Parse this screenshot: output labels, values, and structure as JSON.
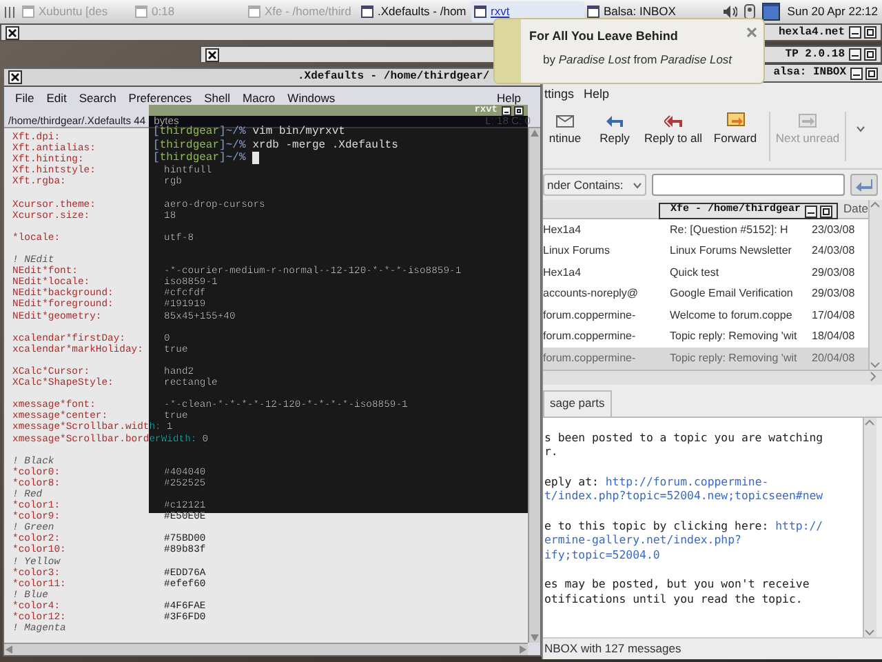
{
  "panel": {
    "tasks": [
      {
        "label": "Xubuntu [des",
        "minimized": true,
        "selected": false
      },
      {
        "label": "0:18",
        "minimized": true,
        "selected": false
      },
      {
        "label": "Xfe - /home/third",
        "minimized": true,
        "selected": false
      },
      {
        "label": ".Xdefaults - /hom",
        "minimized": false,
        "selected": false
      },
      {
        "label": "rxvt",
        "minimized": false,
        "selected": true
      },
      {
        "label": "Balsa: INBOX",
        "minimized": false,
        "selected": false
      }
    ],
    "clock": "Sun 20 Apr 22:12"
  },
  "background_windows": [
    {
      "title": "hexla4.net"
    },
    {
      "title": "TP 2.0.18"
    }
  ],
  "notification": {
    "title": "For All You Leave Behind",
    "text": "by *Paradise Lost* from *Paradise Lost*"
  },
  "editor": {
    "title": ".Xdefaults - /home/thirdgear/",
    "menu": [
      "File",
      "Edit",
      "Search",
      "Preferences",
      "Shell",
      "Macro",
      "Windows",
      "Help"
    ],
    "path": "/home/thirdgear/.Xdefaults 44",
    "path_suffix": "bytes",
    "position": "L: 18  C: 0",
    "lines": [
      {
        "kind": "setting",
        "key": "Xft.dpi:"
      },
      {
        "kind": "setting",
        "key": "Xft.antialias:"
      },
      {
        "kind": "setting",
        "key": "Xft.hinting:"
      },
      {
        "kind": "setting",
        "key": "Xft.hintstyle:",
        "value": "hintfull"
      },
      {
        "kind": "setting",
        "key": "Xft.rgba:",
        "value": "rgb"
      },
      {
        "kind": "blank"
      },
      {
        "kind": "setting",
        "key": "Xcursor.theme:",
        "value": "aero-drop-cursors"
      },
      {
        "kind": "setting",
        "key": "Xcursor.size:",
        "value": "18"
      },
      {
        "kind": "blank"
      },
      {
        "kind": "setting",
        "key": "*locale:",
        "value": "utf-8"
      },
      {
        "kind": "blank"
      },
      {
        "kind": "comment",
        "text": "! NEdit"
      },
      {
        "kind": "setting",
        "key": "NEdit*font:",
        "value": "-*-courier-medium-r-normal--12-120-*-*-*-iso8859-1"
      },
      {
        "kind": "setting",
        "key": "NEdit*locale:",
        "value": "iso8859-1"
      },
      {
        "kind": "setting",
        "key": "NEdit*background:",
        "value": "#cfcfdf"
      },
      {
        "kind": "setting",
        "key": "NEdit*foreground:",
        "value": "#191919"
      },
      {
        "kind": "setting",
        "key": "NEdit*geometry:",
        "value": "85x45+155+40"
      },
      {
        "kind": "blank"
      },
      {
        "kind": "setting",
        "key": "xcalendar*firstDay:",
        "value": "0"
      },
      {
        "kind": "setting",
        "key": "xcalendar*markHoliday:",
        "value": "true"
      },
      {
        "kind": "blank"
      },
      {
        "kind": "setting",
        "key": "XCalc*Cursor:",
        "value": "hand2"
      },
      {
        "kind": "setting",
        "key": "XCalc*ShapeStyle:",
        "value": "rectangle"
      },
      {
        "kind": "blank"
      },
      {
        "kind": "setting",
        "key": "xmessage*font:",
        "value": "-*-clean-*-*-*-*-12-120-*-*-*-*-iso8859-1"
      },
      {
        "kind": "setting",
        "key": "xmessage*center:",
        "value": "true"
      },
      {
        "kind": "setting",
        "key": "xmessage*Scrollbar.width:",
        "value": "1"
      },
      {
        "kind": "setting",
        "key": "xmessage*Scrollbar.borderWidth:",
        "value": "0"
      },
      {
        "kind": "blank"
      },
      {
        "kind": "comment",
        "text": "! Black"
      },
      {
        "kind": "setting",
        "key": "*color0:",
        "value": "#404040"
      },
      {
        "kind": "setting",
        "key": "*color8:",
        "value": "#252525"
      },
      {
        "kind": "comment",
        "text": "! Red"
      },
      {
        "kind": "setting",
        "key": "*color1:",
        "value": "#c12121"
      },
      {
        "kind": "setting",
        "key": "*color9:",
        "value": "#E50E0E"
      },
      {
        "kind": "comment",
        "text": "! Green"
      },
      {
        "kind": "setting",
        "key": "*color2:",
        "value": "#75BD00"
      },
      {
        "kind": "setting",
        "key": "*color10:",
        "value": "#89b83f"
      },
      {
        "kind": "comment",
        "text": "! Yellow"
      },
      {
        "kind": "setting",
        "key": "*color3:",
        "value": "#EDD76A"
      },
      {
        "kind": "setting",
        "key": "*color11:",
        "value": "#efef60"
      },
      {
        "kind": "comment",
        "text": "! Blue"
      },
      {
        "kind": "setting",
        "key": "*color4:",
        "value": "#4F6FAE"
      },
      {
        "kind": "setting",
        "key": "*color12:",
        "value": "#3F6FD0"
      },
      {
        "kind": "comment",
        "text": "! Magenta"
      }
    ]
  },
  "terminal": {
    "title": "rxvt",
    "bracket_open": "[",
    "bracket_close": "]",
    "lines": [
      {
        "user": "thirdgear",
        "prompt": "~/%",
        "command": "vim bin/myrxvt",
        "cursor": false
      },
      {
        "user": "thirdgear",
        "prompt": "~/%",
        "command": "xrdb -merge .Xdefaults",
        "cursor": false
      },
      {
        "user": "thirdgear",
        "prompt": "~/%",
        "cursor": true
      }
    ]
  },
  "mail": {
    "title": "alsa: INBOX",
    "menu": [
      "ttings",
      "Help"
    ],
    "toolbar": [
      {
        "kind": "continue",
        "label": "ntinue",
        "disabled": false
      },
      {
        "kind": "reply",
        "label": "Reply",
        "disabled": false
      },
      {
        "kind": "reply_all",
        "label": "Reply to all",
        "disabled": false
      },
      {
        "kind": "forward",
        "label": "Forward",
        "disabled": false
      },
      {
        "kind": "next",
        "label": "Next unread",
        "disabled": true
      }
    ],
    "filter": {
      "label": "nder Contains:"
    },
    "date_header": "Date",
    "messages": [
      {
        "sender": "Hex1a4",
        "subject": "Re: [Question #5152]: H",
        "date": "23/03/08",
        "selected": false
      },
      {
        "sender": "Linux Forums",
        "subject": "Linux Forums Newsletter",
        "date": "24/03/08",
        "selected": false
      },
      {
        "sender": "Hex1a4",
        "subject": "Quick test",
        "date": "29/03/08",
        "selected": false
      },
      {
        "sender": "accounts-noreply@",
        "subject": "Google Email Verification",
        "date": "29/03/08",
        "selected": false
      },
      {
        "sender": "forum.coppermine-",
        "subject": "Welcome to forum.coppe",
        "date": "17/04/08",
        "selected": false
      },
      {
        "sender": "forum.coppermine-",
        "subject": "Topic reply: Removing 'wit",
        "date": "18/04/08",
        "selected": false
      },
      {
        "sender": "forum.coppermine-",
        "subject": "Topic reply: Removing 'wit",
        "date": "20/04/08",
        "selected": true
      }
    ],
    "tab": "sage parts",
    "body": [
      [
        {
          "text": "s been posted to a topic you are watching"
        },
        {
          "text": "r."
        }
      ],
      [
        {
          "text": "eply at: ",
          "link": "http://forum.coppermine-"
        },
        {
          "link": "t/index.php?topic=52004.new;topicseen#new"
        }
      ],
      [
        {
          "text": "e to this topic by clicking here: ",
          "link": "http://"
        },
        {
          "link": "ermine-gallery.net/index.php?"
        },
        {
          "link": "ify;topic=52004.0"
        }
      ],
      [
        {
          "text": "es may be posted, but you won't receive"
        },
        {
          "text": "otifications until you read the topic."
        }
      ]
    ],
    "status": "NBOX with 127 messages"
  },
  "xfe": {
    "title": "Xfe - /home/thirdgear"
  }
}
